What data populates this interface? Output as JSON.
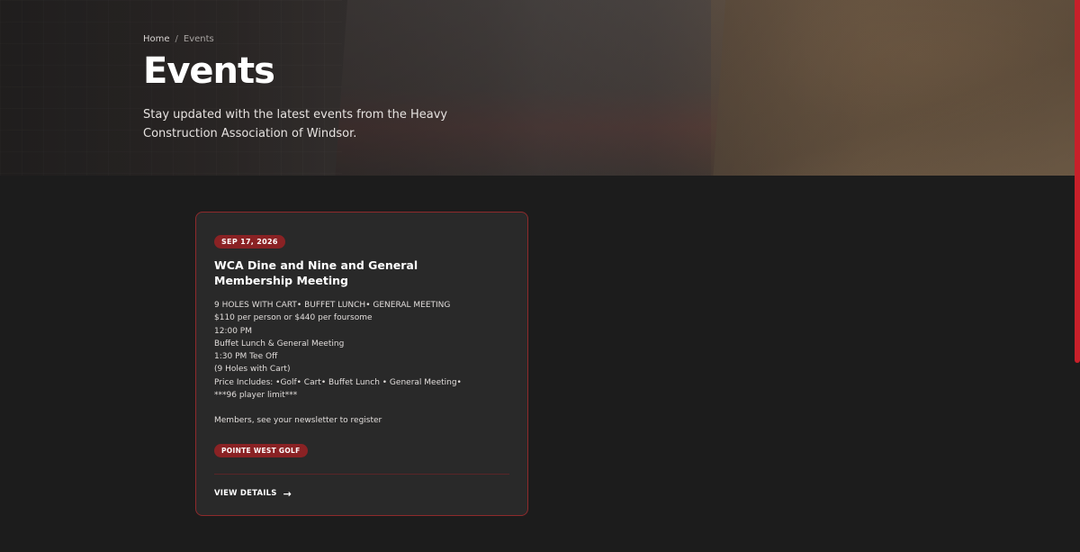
{
  "breadcrumb": {
    "home": "Home",
    "separator": "/",
    "current": "Events"
  },
  "hero": {
    "title": "Events",
    "subtitle": "Stay updated with the latest events from the Heavy Construction Association of Windsor."
  },
  "event_card": {
    "date": "SEP 17, 2026",
    "title": "WCA Dine and Nine and General Membership Meeting",
    "description_lines": [
      "9 HOLES WITH CART• BUFFET LUNCH• GENERAL MEETING",
      "$110 per person or $440 per foursome",
      "12:00 PM",
      "Buffet Lunch & General Meeting",
      "1:30 PM Tee Off",
      "(9 Holes with Cart)",
      "Price Includes: •Golf• Cart• Buffet Lunch • General Meeting•",
      "***96 player limit***",
      "Members, see your newsletter to register"
    ],
    "location": "POINTE WEST GOLF",
    "link_label": "VIEW DETAILS",
    "link_icon": "arrow-right-icon"
  },
  "colors": {
    "accent": "#8a2224",
    "background": "#1c1c1c",
    "card": "#292929",
    "scrollbar": "#c8202a"
  }
}
